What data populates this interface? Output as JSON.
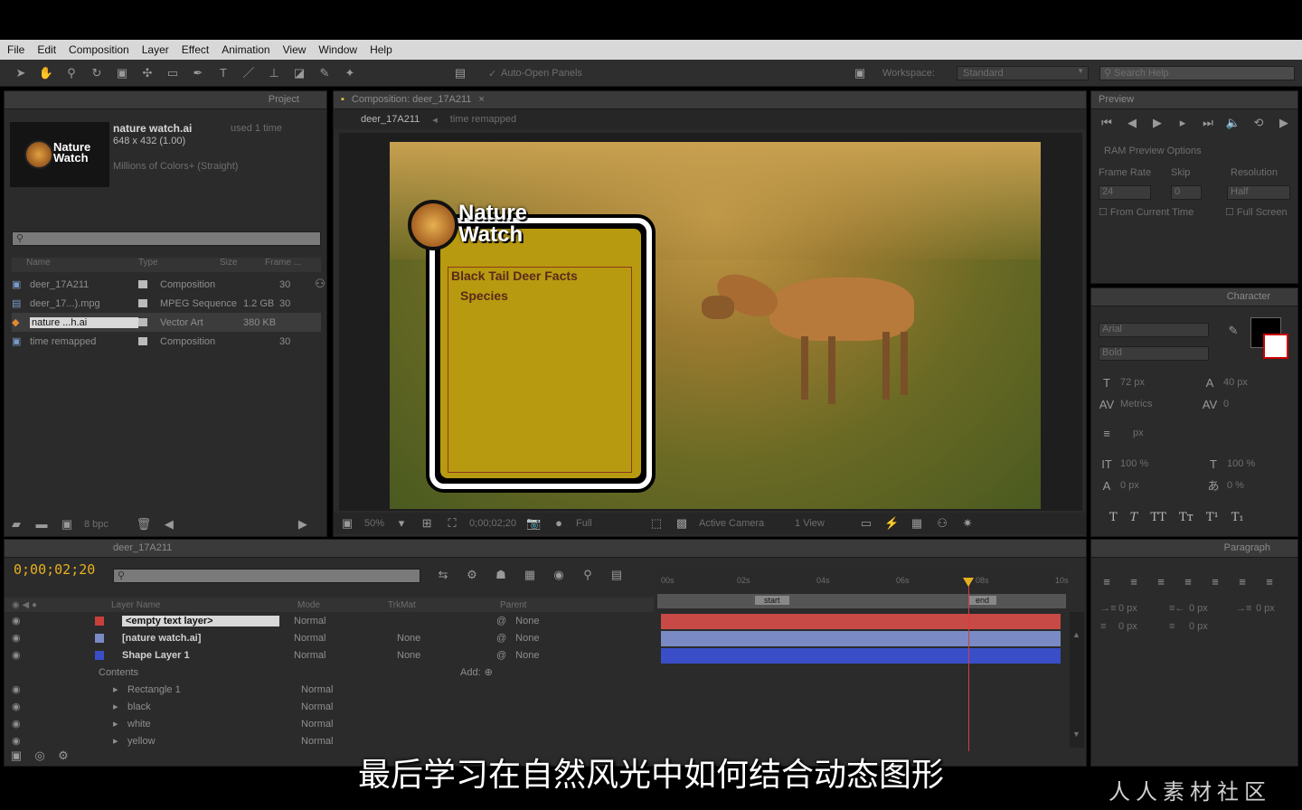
{
  "menu": [
    "File",
    "Edit",
    "Composition",
    "Layer",
    "Effect",
    "Animation",
    "View",
    "Window",
    "Help"
  ],
  "toolbar": {
    "auto_open": "Auto-Open Panels",
    "workspace_label": "Workspace:",
    "workspace_value": "Standard",
    "search_placeholder": "Search Help"
  },
  "project": {
    "tab": "Project",
    "selected_name": "nature watch.ai",
    "selected_usage": "used 1 time",
    "selected_size": "648 x 432 (1.00)",
    "selected_colors": "Millions of Colors+ (Straight)",
    "logo_line1": "Nature",
    "logo_line2": "Watch",
    "columns": [
      "Name",
      "Type",
      "Size",
      "Frame ..."
    ],
    "items": [
      {
        "name": "deer_17A211",
        "type": "Composition",
        "size": "",
        "frame": "30",
        "icon": "composition-icon"
      },
      {
        "name": "deer_17...).mpg",
        "type": "MPEG Sequence",
        "size": "1.2 GB",
        "frame": "30",
        "icon": "footage-icon"
      },
      {
        "name": "nature ...h.ai",
        "type": "Vector Art",
        "size": "380 KB",
        "frame": "",
        "icon": "vector-icon"
      },
      {
        "name": "time remapped",
        "type": "Composition",
        "size": "",
        "frame": "30",
        "icon": "composition-icon"
      }
    ],
    "bpc": "8 bpc"
  },
  "composition": {
    "tab": "Composition: deer_17A211",
    "breadcrumb1": "deer_17A211",
    "breadcrumb2": "time remapped",
    "card_title": "Black Tail Deer Facts",
    "card_species": "Species",
    "zoom": "50%",
    "timecode": "0;00;02;20",
    "resolution": "Full",
    "camera": "Active Camera",
    "views": "1 View"
  },
  "preview": {
    "tab": "Preview",
    "ram_options": "RAM Preview Options",
    "frame_rate_label": "Frame Rate",
    "skip_label": "Skip",
    "resolution_label": "Resolution",
    "frame_rate": "24",
    "skip": "0",
    "resolution": "Half",
    "from_current": "From Current Time",
    "full_screen": "Full Screen"
  },
  "character": {
    "tab": "Character",
    "font": "Arial",
    "style": "Bold",
    "size": "72 px",
    "leading": "40 px",
    "tracking": "Metrics",
    "kerning": "0",
    "stroke": "px",
    "vscale": "100 %",
    "hscale": "100 %",
    "baseline": "0 px",
    "tsume": "0 %"
  },
  "paragraph": {
    "tab": "Paragraph",
    "indent1": "0 px",
    "indent2": "0 px",
    "indent3": "0 px",
    "space1": "0 px",
    "space2": "0 px"
  },
  "timeline": {
    "tab": "deer_17A211",
    "timecode": "0;00;02;20",
    "headers": [
      "Layer Name",
      "Mode",
      "TrkMat",
      "Parent"
    ],
    "add_label": "Add:",
    "contents_label": "Contents",
    "layers": [
      {
        "name": "<empty text layer>",
        "mode": "Normal",
        "trkmat": "",
        "parent": "None",
        "color": "#c8403a"
      },
      {
        "name": "[nature watch.ai]",
        "mode": "Normal",
        "trkmat": "None",
        "parent": "None",
        "color": "#7a8ac4"
      },
      {
        "name": "Shape Layer 1",
        "mode": "Normal",
        "trkmat": "None",
        "parent": "None",
        "color": "#3a4ec8"
      }
    ],
    "contents": [
      {
        "name": "Rectangle 1",
        "mode": "Normal"
      },
      {
        "name": "black",
        "mode": "Normal"
      },
      {
        "name": "white",
        "mode": "Normal"
      },
      {
        "name": "yellow",
        "mode": "Normal"
      }
    ],
    "ruler": [
      "00s",
      "02s",
      "04s",
      "06s",
      "08s",
      "10s"
    ],
    "marker_start": "start",
    "marker_end": "end"
  },
  "subtitle": "最后学习在自然风光中如何结合动态图形",
  "watermark": "人人素材社区"
}
